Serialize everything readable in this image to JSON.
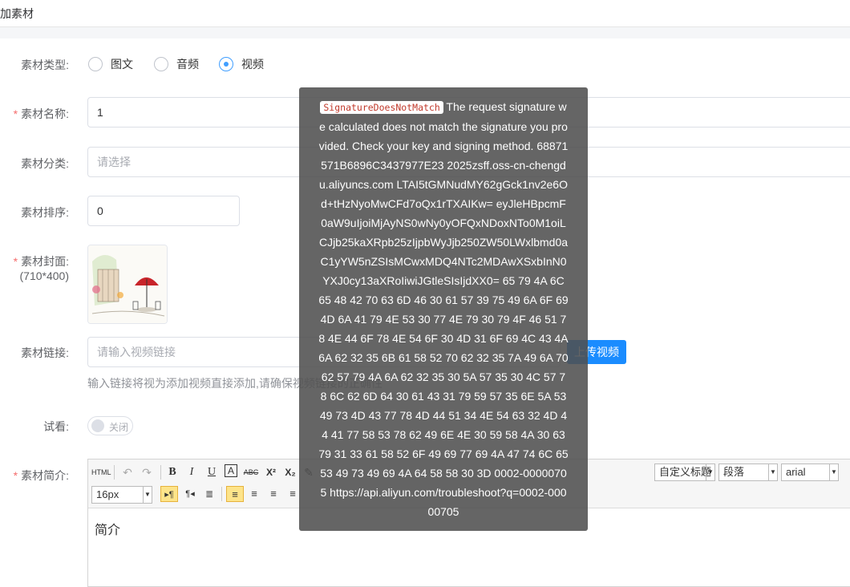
{
  "page": {
    "title": "加素材"
  },
  "form": {
    "type_label": "素材类型:",
    "type_options": [
      "图文",
      "音频",
      "视频"
    ],
    "type_selected": "视频",
    "name_label": "素材名称:",
    "name_value": "1",
    "category_label": "素材分类:",
    "category_placeholder": "请选择",
    "sort_label": "素材排序:",
    "sort_value": "0",
    "cover_label": "素材封面:",
    "cover_size": "(710*400)",
    "link_label": "素材链接:",
    "link_placeholder": "请输入视频链接",
    "upload_button": "上传视频",
    "link_hint": "输入链接将视为添加视频直接添加,请确保视频链接的正确性",
    "trial_label": "试看:",
    "trial_switch": "关闭",
    "intro_label": "素材简介:"
  },
  "editor": {
    "html_btn": "HTML",
    "bold": "B",
    "italic": "I",
    "underline": "U",
    "border_text": "A",
    "strike": "ABC",
    "superscript": "X²",
    "subscript": "X₂",
    "custom_title": "自定义标题",
    "paragraph": "段落",
    "font_family": "arial",
    "font_size": "16px",
    "content": "简介"
  },
  "error": {
    "code": "SignatureDoesNotMatch",
    "message": "The request signature we calculated does not match the signature you provided. Check your key and signing method. 68871571B6896C3437977E23 2025zsff.oss-cn-chengdu.aliyuncs.com LTAI5tGMNudMY62gGck1nv2e6Od+tHzNyoMwCFd7oQx1rTXAIKw= eyJleHBpcmF0aW9uIjoiMjAyNS0wNy0yOFQxNDoxNTo0M1oiLCJjb25kaXRpb25zIjpbWyJjb250ZW50LWxlbmd0aC1yYW5nZSIsMCwxMDQ4NTc2MDAwXSxbInN0YXJ0cy13aXRoIiwiJGtleSIsIjdXX0= 65 79 4A 6C 65 48 42 70 63 6D 46 30 61 57 39 75 49 6A 6F 69 4D 6A 41 79 4E 53 30 77 4E 79 30 79 4F 46 51 78 4E 44 6F 78 4E 54 6F 30 4D 31 6F 69 4C 43 4A 6A 62 32 35 6B 61 58 52 70 62 32 35 7A 49 6A 70 62 57 79 4A 6A 62 32 35 30 5A 57 35 30 4C 57 78 6C 62 6D 64 30 61 43 31 79 59 57 35 6E 5A 53 49 73 4D 43 77 78 4D 44 51 34 4E 54 63 32 4D 44 41 77 58 53 78 62 49 6E 4E 30 59 58 4A 30 63 79 31 33 61 58 52 6F 49 69 77 69 4A 47 74 6C 65 53 49 73 49 69 4A 64 58 58 30 3D 0002-00000705 https://api.aliyun.com/troubleshoot?q=0002-00000705"
  }
}
